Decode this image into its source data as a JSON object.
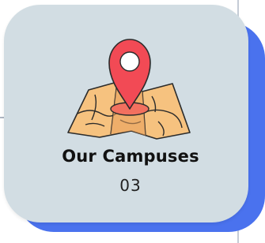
{
  "card": {
    "title": "Our Campuses",
    "count": "03",
    "icon": "map-location-pin-icon"
  },
  "colors": {
    "card_background": "#d2dde3",
    "accent_panel": "#4a72ee",
    "pin": "#f24a55",
    "map": "#f6c27f"
  }
}
